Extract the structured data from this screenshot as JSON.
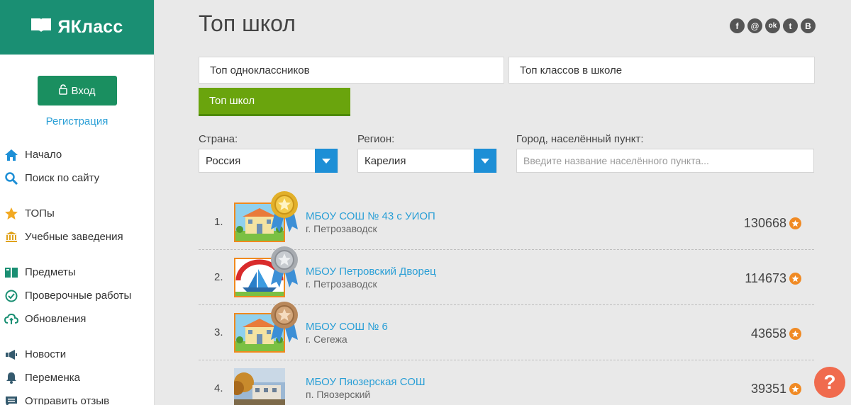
{
  "brand": {
    "name": "ЯКласс"
  },
  "auth": {
    "login_label": "Вход",
    "register_label": "Регистрация"
  },
  "nav": {
    "groups": [
      [
        {
          "label": "Начало",
          "icon": "home-icon"
        },
        {
          "label": "Поиск по сайту",
          "icon": "search-icon"
        }
      ],
      [
        {
          "label": "ТОПы",
          "icon": "star-icon"
        },
        {
          "label": "Учебные заведения",
          "icon": "institution-icon"
        }
      ],
      [
        {
          "label": "Предметы",
          "icon": "books-icon"
        },
        {
          "label": "Проверочные работы",
          "icon": "check-circle-icon"
        },
        {
          "label": "Обновления",
          "icon": "cloud-sync-icon"
        }
      ],
      [
        {
          "label": "Новости",
          "icon": "megaphone-icon"
        },
        {
          "label": "Переменка",
          "icon": "bell-icon"
        },
        {
          "label": "Отправить отзыв",
          "icon": "feedback-icon"
        }
      ]
    ]
  },
  "page": {
    "title": "Топ школ"
  },
  "social": [
    {
      "label": "f",
      "icon": "facebook-icon"
    },
    {
      "label": "@",
      "icon": "mail-icon"
    },
    {
      "label": "ok",
      "icon": "odnoklassniki-icon"
    },
    {
      "label": "t",
      "icon": "twitter-icon"
    },
    {
      "label": "В",
      "icon": "vk-icon"
    }
  ],
  "tabs": {
    "classmates": "Топ одноклассников",
    "classes": "Топ классов в школе",
    "schools": "Топ школ"
  },
  "filters": {
    "country_label": "Страна:",
    "country_value": "Россия",
    "region_label": "Регион:",
    "region_value": "Карелия",
    "city_label": "Город, населённый пункт:",
    "city_placeholder": "Введите название населённого пункта..."
  },
  "schools": [
    {
      "rank": "1.",
      "name": "МБОУ СОШ № 43 с УИОП",
      "city": "г. Петрозаводск",
      "score": "130668",
      "medal": "gold",
      "medal_color": "#e2b02a"
    },
    {
      "rank": "2.",
      "name": "МБОУ Петровский Дворец",
      "city": "г. Петрозаводск",
      "score": "114673",
      "medal": "silver",
      "medal_color": "#a7abb0"
    },
    {
      "rank": "3.",
      "name": "МБОУ СОШ № 6",
      "city": "г. Сегежа",
      "score": "43658",
      "medal": "bronze",
      "medal_color": "#b8875a"
    },
    {
      "rank": "4.",
      "name": "МБОУ Пяозерская СОШ",
      "city": "п. Пяозерский",
      "score": "39351",
      "medal": "none",
      "medal_color": ""
    }
  ],
  "colors": {
    "brand_green": "#1a8f73",
    "accent_green": "#6aa40d",
    "link_blue": "#2a9fd6",
    "select_blue": "#1d8fd6",
    "score_orange": "#f08a24"
  }
}
